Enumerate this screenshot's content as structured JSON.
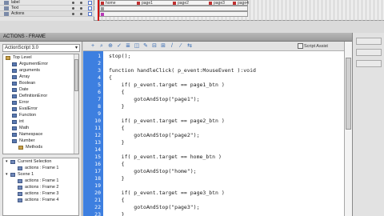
{
  "timeline": {
    "layers": [
      {
        "name": "label"
      },
      {
        "name": "Text"
      },
      {
        "name": "Actions"
      }
    ],
    "frame_labels": [
      "home",
      "page1",
      "page2",
      "page3",
      "page4"
    ]
  },
  "panel": {
    "title": "ACTIONS - FRAME"
  },
  "left": {
    "version": "ActionScript 3.0",
    "library": [
      {
        "label": "Top Level",
        "indent": 0,
        "icon": "book"
      },
      {
        "label": "ArgumentError",
        "indent": 1,
        "icon": "class"
      },
      {
        "label": "arguments",
        "indent": 1,
        "icon": "class"
      },
      {
        "label": "Array",
        "indent": 1,
        "icon": "class"
      },
      {
        "label": "Boolean",
        "indent": 1,
        "icon": "class"
      },
      {
        "label": "Date",
        "indent": 1,
        "icon": "class"
      },
      {
        "label": "DefinitionError",
        "indent": 1,
        "icon": "class"
      },
      {
        "label": "Error",
        "indent": 1,
        "icon": "class"
      },
      {
        "label": "EvalError",
        "indent": 1,
        "icon": "class"
      },
      {
        "label": "Function",
        "indent": 1,
        "icon": "class"
      },
      {
        "label": "int",
        "indent": 1,
        "icon": "class"
      },
      {
        "label": "Math",
        "indent": 1,
        "icon": "class"
      },
      {
        "label": "Namespace",
        "indent": 1,
        "icon": "class"
      },
      {
        "label": "Number",
        "indent": 1,
        "icon": "class"
      },
      {
        "label": "Methods",
        "indent": 2,
        "icon": "book"
      }
    ],
    "scenes": [
      {
        "label": "Current Selection",
        "indent": 0,
        "caret": "▾"
      },
      {
        "label": "actions : Frame 1",
        "indent": 1,
        "caret": ""
      },
      {
        "label": "Scene 1",
        "indent": 0,
        "caret": "▾"
      },
      {
        "label": "actions : Frame 1",
        "indent": 1,
        "caret": ""
      },
      {
        "label": "actions : Frame 2",
        "indent": 1,
        "caret": ""
      },
      {
        "label": "actions : Frame 3",
        "indent": 1,
        "caret": ""
      },
      {
        "label": "actions : Frame 4",
        "indent": 1,
        "caret": ""
      }
    ]
  },
  "toolbar": {
    "icons": [
      "add-icon",
      "find-icon",
      "target-icon",
      "check-syntax-icon",
      "auto-format-icon",
      "code-hint-icon",
      "debug-icon",
      "collapse-icon",
      "expand-icon",
      "comment-icon",
      "uncomment-icon",
      "toggle-icon"
    ],
    "script_assist": "Script Assist",
    "help": "?"
  },
  "editor": {
    "lines": [
      {
        "n": "1",
        "text": "stop();"
      },
      {
        "n": "2",
        "text": ""
      },
      {
        "n": "3",
        "text": "function handleClick( p_event:MouseEvent ):void"
      },
      {
        "n": "4",
        "text": "{"
      },
      {
        "n": "5",
        "text": "    if( p_event.target == page1_btn )"
      },
      {
        "n": "6",
        "text": "    {"
      },
      {
        "n": "7",
        "text": "        gotoAndStop(\"page1\");"
      },
      {
        "n": "8",
        "text": "    }"
      },
      {
        "n": "9",
        "text": ""
      },
      {
        "n": "10",
        "text": "    if( p_event.target == page2_btn )"
      },
      {
        "n": "11",
        "text": "    {"
      },
      {
        "n": "12",
        "text": "        gotoAndStop(\"page2\");"
      },
      {
        "n": "13",
        "text": "    }"
      },
      {
        "n": "14",
        "text": ""
      },
      {
        "n": "15",
        "text": "    if( p_event.target == home_btn )"
      },
      {
        "n": "16",
        "text": "    {"
      },
      {
        "n": "17",
        "text": "        gotoAndStop(\"home\");"
      },
      {
        "n": "18",
        "text": "    }"
      },
      {
        "n": "19",
        "text": ""
      },
      {
        "n": "20",
        "text": "    if( p_event.target == page3_btn )"
      },
      {
        "n": "21",
        "text": "    {"
      },
      {
        "n": "22",
        "text": "        gotoAndStop(\"page3\");"
      },
      {
        "n": "23",
        "text": "    }"
      }
    ]
  }
}
